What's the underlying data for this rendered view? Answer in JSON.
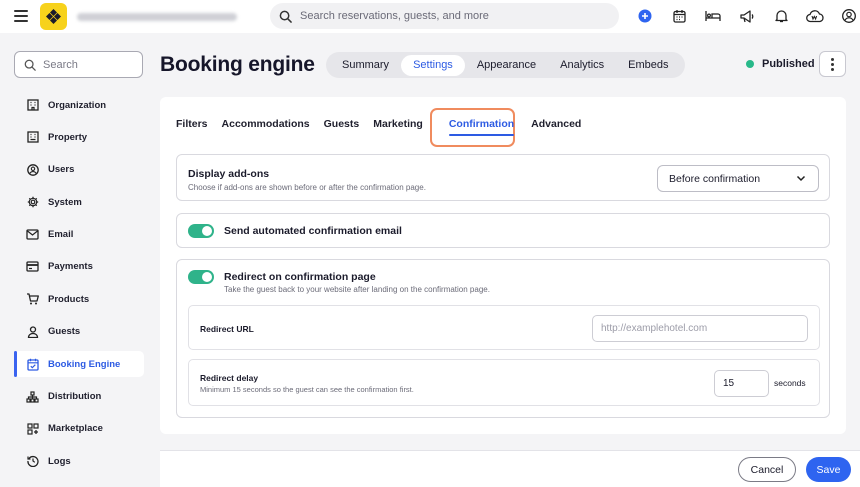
{
  "topbar": {
    "search_placeholder": "Search reservations, guests, and more",
    "icons": [
      "add-circle-icon",
      "calendar-icon",
      "bed-icon",
      "megaphone-icon",
      "bell-icon",
      "cloud-w-icon",
      "user-circle-icon"
    ]
  },
  "sidebar": {
    "search_placeholder": "Search",
    "items": [
      {
        "label": "Organization",
        "icon": "building-icon"
      },
      {
        "label": "Property",
        "icon": "property-icon"
      },
      {
        "label": "Users",
        "icon": "user-icon"
      },
      {
        "label": "System",
        "icon": "gear-icon"
      },
      {
        "label": "Email",
        "icon": "mail-icon"
      },
      {
        "label": "Payments",
        "icon": "card-icon"
      },
      {
        "label": "Products",
        "icon": "cart-icon"
      },
      {
        "label": "Guests",
        "icon": "person-icon"
      },
      {
        "label": "Booking Engine",
        "icon": "calendar-check-icon"
      },
      {
        "label": "Distribution",
        "icon": "hierarchy-icon"
      },
      {
        "label": "Marketplace",
        "icon": "grid-plus-icon"
      },
      {
        "label": "Logs",
        "icon": "history-icon"
      }
    ],
    "active_index": 8
  },
  "header": {
    "title": "Booking engine",
    "tabs": [
      "Summary",
      "Settings",
      "Appearance",
      "Analytics",
      "Embeds"
    ],
    "active_tab": "Settings",
    "status": "Published",
    "status_color": "#28b98a"
  },
  "subtabs": {
    "items": [
      "Filters",
      "Accommodations",
      "Guests",
      "Marketing",
      "Confirmation",
      "Advanced"
    ],
    "active": "Confirmation"
  },
  "display_addons": {
    "title": "Display add-ons",
    "description": "Choose if add-ons are shown before or after the confirmation page.",
    "selected": "Before confirmation"
  },
  "send_email": {
    "title": "Send automated confirmation email",
    "enabled": true
  },
  "redirect": {
    "title": "Redirect on confirmation page",
    "description": "Take the guest back to your website after landing on the confirmation page.",
    "enabled": true,
    "url_label": "Redirect URL",
    "url_placeholder": "http://examplehotel.com",
    "delay_label": "Redirect delay",
    "delay_description": "Minimum 15 seconds so the guest can see the confirmation first.",
    "delay_value": "15",
    "delay_unit": "seconds"
  },
  "footer": {
    "cancel": "Cancel",
    "save": "Save"
  },
  "colors": {
    "accent": "#2e64f0",
    "toggle_on": "#2fb38a",
    "highlight": "#f08b5e",
    "logo": "#f7d21c"
  }
}
